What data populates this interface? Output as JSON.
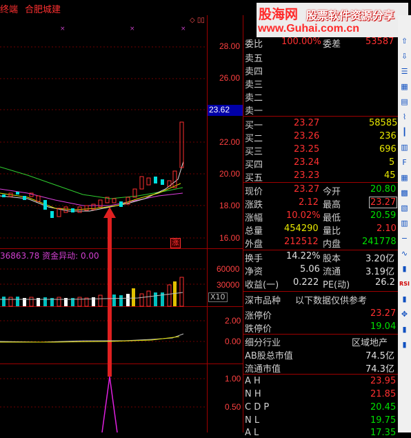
{
  "title": {
    "left_text": "终端",
    "stock_name": "合肥城建"
  },
  "watermark": {
    "brand": "股海网",
    "tagline": "股票软件资源分享",
    "url": "www.Guhai.com.cn"
  },
  "price_axis": {
    "labels": [
      "28.00",
      "26.00",
      "22.00",
      "20.00",
      "18.00",
      "16.00"
    ],
    "current": "23.62"
  },
  "volume_axis": {
    "labels": [
      "60000",
      "30000"
    ],
    "scale": "X10"
  },
  "indicator_axis": {
    "labels": [
      "2.00",
      "0.00"
    ]
  },
  "bottom_axis": {
    "labels": [
      "1.00",
      "0.50"
    ]
  },
  "volume_legend": {
    "value": "36863.78",
    "label": "资金异动:",
    "flow": "0.00"
  },
  "chart_marks": {
    "limit_up": "涨"
  },
  "order_book": {
    "header": {
      "label1": "委比",
      "value1": "100.00%",
      "label2": "委差",
      "value2": "53587"
    },
    "asks": [
      {
        "label": "卖五"
      },
      {
        "label": "卖四"
      },
      {
        "label": "卖三"
      },
      {
        "label": "卖二"
      },
      {
        "label": "卖一"
      }
    ],
    "bids": [
      {
        "label": "买一",
        "price": "23.27",
        "vol": "58585"
      },
      {
        "label": "买二",
        "price": "23.26",
        "vol": "236"
      },
      {
        "label": "买三",
        "price": "23.25",
        "vol": "696"
      },
      {
        "label": "买四",
        "price": "23.24",
        "vol": "5"
      },
      {
        "label": "买五",
        "price": "23.23",
        "vol": "45"
      }
    ]
  },
  "quote": {
    "rows": [
      {
        "l1": "现价",
        "v1": "23.27",
        "l2": "今开",
        "v2": "20.80"
      },
      {
        "l1": "涨跌",
        "v1": "2.12",
        "l2": "最高",
        "v2": "23.27"
      },
      {
        "l1": "涨幅",
        "v1": "10.02%",
        "l2": "最低",
        "v2": "20.59"
      },
      {
        "l1": "总量",
        "v1": "454290",
        "l2": "量比",
        "v2": "2.10"
      },
      {
        "l1": "外盘",
        "v1": "212512",
        "l2": "内盘",
        "v2": "241778"
      },
      {
        "l1": "换手",
        "v1": "14.22%",
        "l2": "股本",
        "v2": "3.20亿"
      },
      {
        "l1": "净资",
        "v1": "5.06",
        "l2": "流通",
        "v2": "3.19亿"
      },
      {
        "l1": "收益(一)",
        "v1": "0.222",
        "l2": "PE(动)",
        "v2": "26.2"
      }
    ]
  },
  "info": {
    "market_label": "深市品种",
    "market_note": "以下数据仅供参考",
    "limit_up_label": "涨停价",
    "limit_up": "23.27",
    "limit_down_label": "跌停价",
    "limit_down": "19.04",
    "industry_label": "细分行业",
    "industry": "区域地产",
    "ab_cap_label": "AB股总市值",
    "ab_cap": "74.5亿",
    "float_cap_label": "流通市值",
    "float_cap": "74.3亿",
    "extra": [
      {
        "label": "A H",
        "value": "23.95"
      },
      {
        "label": "N H",
        "value": "21.85"
      },
      {
        "label": "C D P",
        "value": "20.45"
      },
      {
        "label": "N L",
        "value": "19.75"
      },
      {
        "label": "A L",
        "value": "17.35"
      }
    ]
  },
  "sidebar": {
    "buttons": [
      "up-arrow-icon",
      "down-arrow-icon",
      "list-icon",
      "grid-icon",
      "table-icon",
      "line-chart-icon",
      "candle-icon",
      "bars-icon",
      "f10-icon",
      "grid2-icon",
      "grid3-icon",
      "depth-icon",
      "bars2-icon",
      "minus-icon",
      "wave-icon",
      "bar3-icon",
      "rsi-icon",
      "bar4-icon",
      "cross-icon",
      "bar5-icon",
      "bar6-icon"
    ],
    "rsi_label": "RSI"
  }
}
